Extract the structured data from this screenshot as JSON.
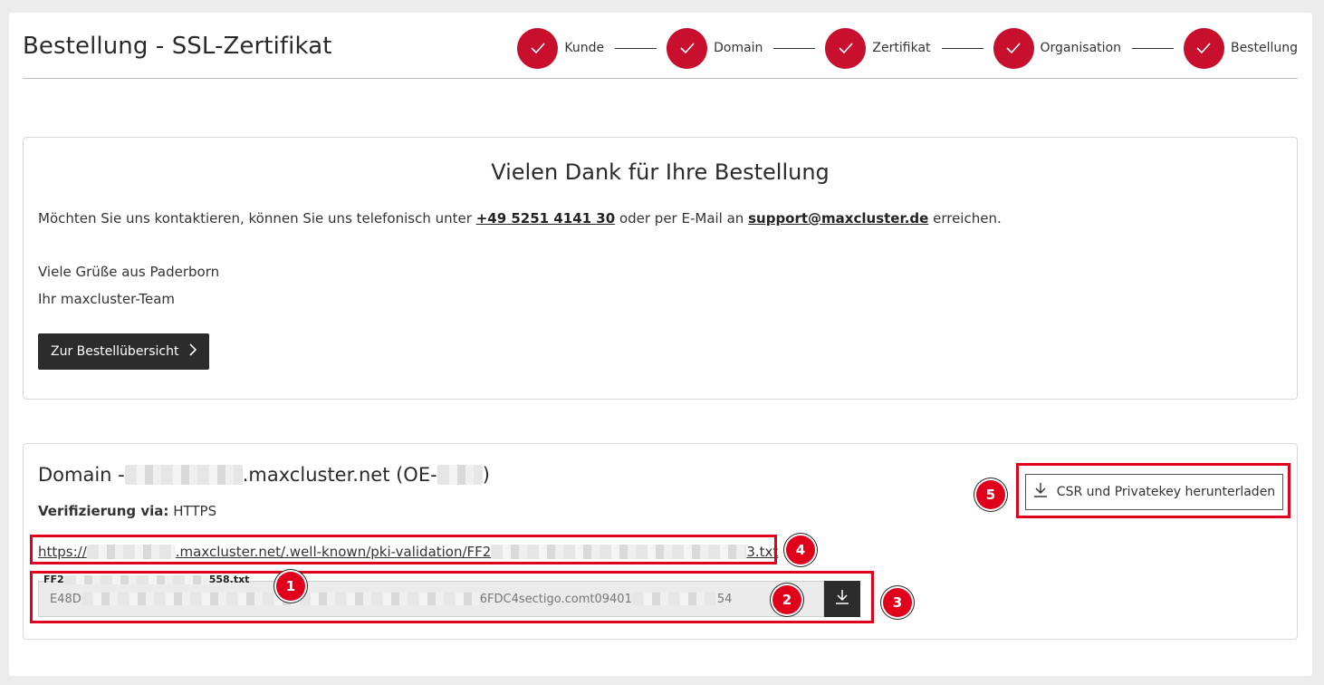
{
  "header": {
    "title": "Bestellung - SSL-Zertifikat",
    "steps": [
      {
        "label": "Kunde",
        "status": "done"
      },
      {
        "label": "Domain",
        "status": "done"
      },
      {
        "label": "Zertifikat",
        "status": "done"
      },
      {
        "label": "Organisation",
        "status": "done"
      },
      {
        "label": "Bestellung",
        "status": "done"
      }
    ]
  },
  "thanks": {
    "heading": "Vielen Dank für Ihre Bestellung",
    "contact_prefix": "Möchten Sie uns kontaktieren, können Sie uns telefonisch unter ",
    "phone": "+49 5251 4141 30",
    "contact_middle": " oder per E-Mail an ",
    "email": "support@maxcluster.de",
    "contact_suffix": " erreichen.",
    "greeting": "Viele Grüße aus Paderborn",
    "signature": "Ihr maxcluster-Team",
    "overview_button": "Zur Bestellübersicht"
  },
  "domain": {
    "title_prefix": "Domain - ",
    "title_domain_suffix": ".maxcluster.net (OE-",
    "title_end": ")",
    "verification_label": "Verifizierung via:",
    "verification_value": "HTTPS",
    "url_prefix": "https://",
    "url_middle": ".maxcluster.net/.well-known/pki-validation/FF2",
    "url_end": "3.txt",
    "file_name_prefix": "FF2",
    "file_name_suffix": "558.txt",
    "field_prefix": "E48D",
    "field_middle": "6FDC4sectigo.comt09401",
    "field_end": "54",
    "csr_button": "CSR und Privatekey herunterladen"
  },
  "annotations": [
    "1",
    "2",
    "3",
    "4",
    "5"
  ],
  "colors": {
    "accent": "#c8102e",
    "annotation": "#e0001b",
    "dark_button": "#2c2c2c"
  }
}
